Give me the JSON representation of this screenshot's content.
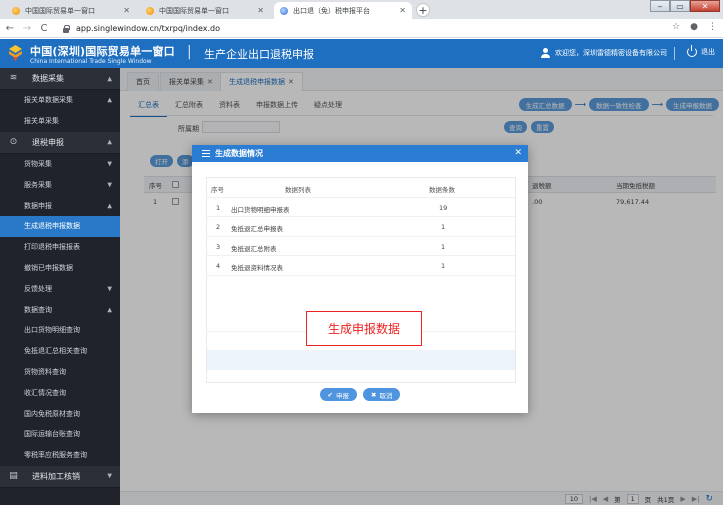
{
  "browser": {
    "tabs": [
      {
        "label": "中国国际贸易单一窗口",
        "close": "✕"
      },
      {
        "label": "中国国际贸易单一窗口",
        "close": "✕"
      },
      {
        "label": "出口退（免）税申报平台",
        "close": "✕"
      }
    ],
    "new_tab": "+",
    "window_buttons": {
      "minimize": "‒",
      "maximize": "▭",
      "close": "✕"
    },
    "nav": {
      "back": "←",
      "forward": "→",
      "reload": "C"
    },
    "url": "app.singlewindow.cn/txrpq/index.do",
    "addr_icons": {
      "star": "☆",
      "profile": "●",
      "menu": "⋮"
    }
  },
  "header": {
    "brand_cn": "中国(深圳)国际贸易单一窗口",
    "brand_en": "China International Trade Single Window",
    "separator": "|",
    "app_title": "生产企业出口退税申报",
    "welcome": "欢迎您，深圳雷德精密设备有限公司",
    "logout": "退出"
  },
  "sidebar": {
    "groups": [
      {
        "label": "数据采集",
        "icon": "database-icon",
        "glyph": "≋",
        "caret": "▲",
        "items": [
          {
            "label": "报关单数据采集",
            "caret": "▲"
          },
          {
            "label": "报关单采集",
            "caret": ""
          }
        ]
      },
      {
        "label": "退税申报",
        "icon": "box-icon",
        "glyph": "⊙",
        "caret": "▲",
        "items": [
          {
            "label": "货物采集",
            "caret": "▼"
          },
          {
            "label": "服务采集",
            "caret": "▼"
          },
          {
            "label": "数据申报",
            "caret": "▲"
          },
          {
            "label": "生成退税申报数据",
            "caret": "",
            "active": true
          },
          {
            "label": "打印退税申报报表",
            "caret": ""
          },
          {
            "label": "撤销已申报数据",
            "caret": ""
          },
          {
            "label": "反馈处理",
            "caret": "▼"
          },
          {
            "label": "数据查询",
            "caret": "▲"
          },
          {
            "label": "出口货物明细查询",
            "caret": ""
          },
          {
            "label": "免抵退汇总相关查询",
            "caret": ""
          },
          {
            "label": "货物资料查询",
            "caret": ""
          },
          {
            "label": "收汇情况查询",
            "caret": ""
          },
          {
            "label": "国内免税原材查询",
            "caret": ""
          },
          {
            "label": "国际运输台账查询",
            "caret": ""
          },
          {
            "label": "零税率应税服务查询",
            "caret": ""
          }
        ]
      },
      {
        "label": "进料加工核销",
        "icon": "doc-icon",
        "glyph": "▤",
        "caret": "▼",
        "items": []
      }
    ]
  },
  "main": {
    "nav_tabs": [
      {
        "label": "首页",
        "close": ""
      },
      {
        "label": "报关单采集",
        "close": "✕"
      },
      {
        "label": "生成退税申报数据",
        "close": "✕"
      }
    ],
    "sub_tabs": [
      "汇总表",
      "汇总附表",
      "资料表",
      "申报数据上传",
      "疑点处理"
    ],
    "flow_buttons": [
      "生成汇总数据",
      "数据一致性检查",
      "生成申报数据"
    ],
    "flow_arrow": "⟶",
    "period_label": "所属期",
    "period_value": "",
    "search_button": "查询",
    "reset_button": "重置",
    "tool_buttons": [
      "打开",
      "添"
    ],
    "grid": {
      "columns": [
        "序号",
        "",
        "退税额",
        "当期免抵税额"
      ],
      "rows": [
        {
          "index": "1",
          "refund": ".00",
          "exempt": "79,617.44"
        }
      ]
    },
    "pager": {
      "page_size": "10",
      "page_label": "第",
      "page": "1",
      "page_unit": "页",
      "total": "共1页",
      "first": "|◀",
      "prev": "◀",
      "next": "▶",
      "last": "▶|",
      "refresh": "↻"
    }
  },
  "modal": {
    "title": "生成数据情况",
    "close": "✕",
    "columns": [
      "序号",
      "数据列表",
      "数据条数"
    ],
    "rows": [
      {
        "index": "1",
        "name": "出口货物明细申报表",
        "count": "19"
      },
      {
        "index": "2",
        "name": "免抵退汇总申报表",
        "count": "1"
      },
      {
        "index": "3",
        "name": "免抵退汇总附表",
        "count": "1"
      },
      {
        "index": "4",
        "name": "免抵退资料情况表",
        "count": "1"
      }
    ],
    "annotation": "生成申报数据",
    "confirm_button": "申报",
    "cancel_button": "取消"
  }
}
